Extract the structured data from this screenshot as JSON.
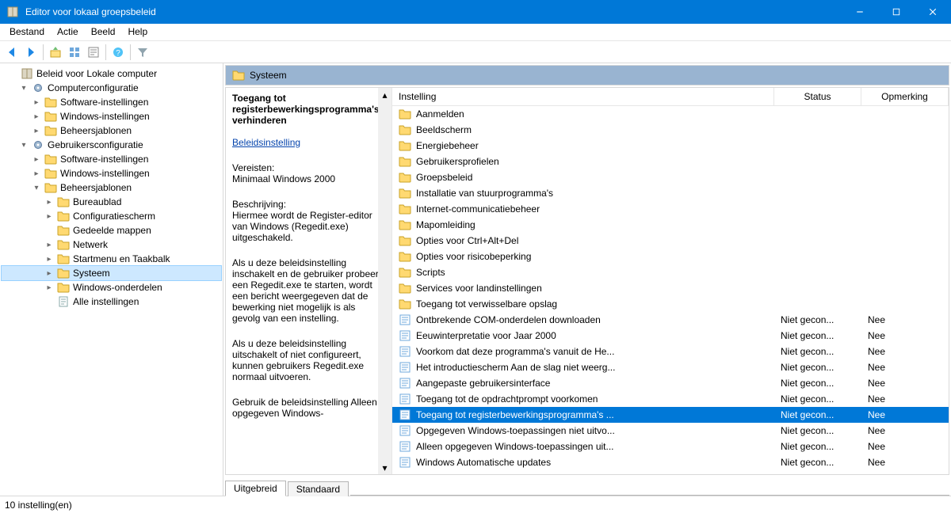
{
  "window": {
    "title": "Editor voor lokaal groepsbeleid"
  },
  "menu": {
    "items": [
      "Bestand",
      "Actie",
      "Beeld",
      "Help"
    ]
  },
  "toolbar": {
    "items": [
      {
        "name": "back-icon"
      },
      {
        "name": "fwd-icon"
      },
      {
        "sep": true
      },
      {
        "name": "up-icon"
      },
      {
        "name": "views-icon"
      },
      {
        "name": "properties-icon"
      },
      {
        "sep": true
      },
      {
        "name": "help-icon"
      },
      {
        "sep": true
      },
      {
        "name": "filter-icon"
      }
    ]
  },
  "tree": {
    "nodes": [
      {
        "label": "Beleid voor Lokale computer",
        "indent": 0,
        "twisty": "",
        "icon": "book"
      },
      {
        "label": "Computerconfiguratie",
        "indent": 1,
        "twisty": "▾",
        "icon": "gear"
      },
      {
        "label": "Software-instellingen",
        "indent": 2,
        "twisty": "▸",
        "icon": "folder"
      },
      {
        "label": "Windows-instellingen",
        "indent": 2,
        "twisty": "▸",
        "icon": "folder"
      },
      {
        "label": "Beheersjablonen",
        "indent": 2,
        "twisty": "▸",
        "icon": "folder"
      },
      {
        "label": "Gebruikersconfiguratie",
        "indent": 1,
        "twisty": "▾",
        "icon": "gear"
      },
      {
        "label": "Software-instellingen",
        "indent": 2,
        "twisty": "▸",
        "icon": "folder"
      },
      {
        "label": "Windows-instellingen",
        "indent": 2,
        "twisty": "▸",
        "icon": "folder"
      },
      {
        "label": "Beheersjablonen",
        "indent": 2,
        "twisty": "▾",
        "icon": "folder"
      },
      {
        "label": "Bureaublad",
        "indent": 3,
        "twisty": "▸",
        "icon": "folder"
      },
      {
        "label": "Configuratiescherm",
        "indent": 3,
        "twisty": "▸",
        "icon": "folder"
      },
      {
        "label": "Gedeelde mappen",
        "indent": 3,
        "twisty": "",
        "icon": "folder"
      },
      {
        "label": "Netwerk",
        "indent": 3,
        "twisty": "▸",
        "icon": "folder"
      },
      {
        "label": "Startmenu en Taakbalk",
        "indent": 3,
        "twisty": "▸",
        "icon": "folder"
      },
      {
        "label": "Systeem",
        "indent": 3,
        "twisty": "▸",
        "icon": "folder",
        "selected": true
      },
      {
        "label": "Windows-onderdelen",
        "indent": 3,
        "twisty": "▸",
        "icon": "folder"
      },
      {
        "label": "Alle instellingen",
        "indent": 3,
        "twisty": "",
        "icon": "paper"
      }
    ]
  },
  "right_header": {
    "icon": "folder",
    "label": "Systeem"
  },
  "description": {
    "title": "Toegang tot registerbewerkingsprogramma's verhinderen",
    "edit_link": "Beleidsinstelling",
    "req_label": "Vereisten:",
    "req_text": "Minimaal Windows 2000",
    "desc_label": "Beschrijving:",
    "desc_p1": "Hiermee wordt de Register-editor van Windows (Regedit.exe) uitgeschakeld.",
    "desc_p2": "Als u deze beleidsinstelling inschakelt en de gebruiker probeert een Regedit.exe te starten, wordt een bericht weergegeven dat de bewerking niet mogelijk is als gevolg van een instelling.",
    "desc_p3": "Als u deze beleidsinstelling uitschakelt of niet configureert, kunnen gebruikers Regedit.exe normaal uitvoeren.",
    "desc_p4": "Gebruik de beleidsinstelling Alleen opgegeven Windows-"
  },
  "columns": {
    "setting": "Instelling",
    "status": "Status",
    "comment": "Opmerking"
  },
  "list": [
    {
      "type": "folder",
      "name": "Aanmelden"
    },
    {
      "type": "folder",
      "name": "Beeldscherm"
    },
    {
      "type": "folder",
      "name": "Energiebeheer"
    },
    {
      "type": "folder",
      "name": "Gebruikersprofielen"
    },
    {
      "type": "folder",
      "name": "Groepsbeleid"
    },
    {
      "type": "folder",
      "name": "Installatie van stuurprogramma's"
    },
    {
      "type": "folder",
      "name": "Internet-communicatiebeheer"
    },
    {
      "type": "folder",
      "name": "Mapomleiding"
    },
    {
      "type": "folder",
      "name": "Opties voor Ctrl+Alt+Del"
    },
    {
      "type": "folder",
      "name": "Opties voor risicobeperking"
    },
    {
      "type": "folder",
      "name": "Scripts"
    },
    {
      "type": "folder",
      "name": "Services voor landinstellingen"
    },
    {
      "type": "folder",
      "name": "Toegang tot verwisselbare opslag"
    },
    {
      "type": "setting",
      "name": "Ontbrekende COM-onderdelen downloaden",
      "status": "Niet gecon...",
      "comment": "Nee"
    },
    {
      "type": "setting",
      "name": "Eeuwinterpretatie voor Jaar 2000",
      "status": "Niet gecon...",
      "comment": "Nee"
    },
    {
      "type": "setting",
      "name": "Voorkom dat deze programma's vanuit de He...",
      "status": "Niet gecon...",
      "comment": "Nee"
    },
    {
      "type": "setting",
      "name": "Het introductiescherm Aan de slag niet weerg...",
      "status": "Niet gecon...",
      "comment": "Nee"
    },
    {
      "type": "setting",
      "name": "Aangepaste gebruikersinterface",
      "status": "Niet gecon...",
      "comment": "Nee"
    },
    {
      "type": "setting",
      "name": "Toegang tot de opdrachtprompt voorkomen",
      "status": "Niet gecon...",
      "comment": "Nee"
    },
    {
      "type": "setting",
      "name": "Toegang tot registerbewerkingsprogramma's ...",
      "status": "Niet gecon...",
      "comment": "Nee",
      "selected": true
    },
    {
      "type": "setting",
      "name": "Opgegeven Windows-toepassingen niet uitvo...",
      "status": "Niet gecon...",
      "comment": "Nee"
    },
    {
      "type": "setting",
      "name": "Alleen opgegeven Windows-toepassingen uit...",
      "status": "Niet gecon...",
      "comment": "Nee"
    },
    {
      "type": "setting",
      "name": "Windows Automatische updates",
      "status": "Niet gecon...",
      "comment": "Nee"
    }
  ],
  "tabs": {
    "extended": "Uitgebreid",
    "standard": "Standaard"
  },
  "statusbar": "10 instelling(en)"
}
